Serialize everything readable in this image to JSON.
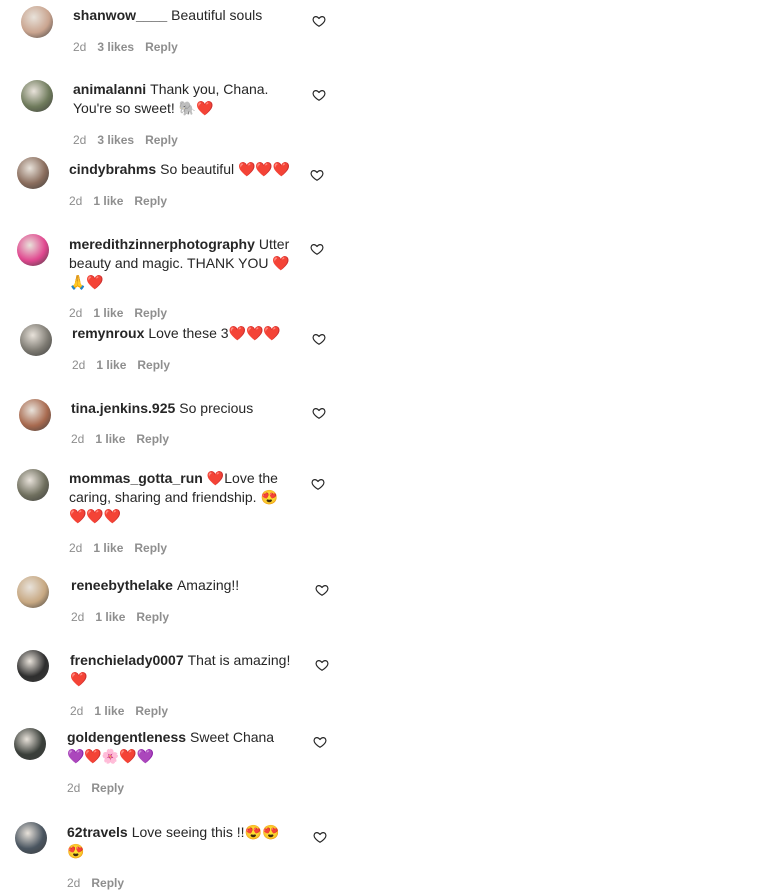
{
  "comments": [
    {
      "username": "shanwow____",
      "text": "Beautiful souls",
      "time": "2d",
      "likes": "3 likes",
      "reply": "Reply",
      "avatar_color": "#c9a48f"
    },
    {
      "username": "animalanni",
      "text": "Thank you, Chana. You're so sweet! 🐘❤️",
      "time": "2d",
      "likes": "3 likes",
      "reply": "Reply",
      "avatar_color": "#6f7b5c"
    },
    {
      "username": "cindybrahms",
      "text": "So beautiful ❤️❤️❤️",
      "time": "2d",
      "likes": "1 like",
      "reply": "Reply",
      "avatar_color": "#8a6d5d"
    },
    {
      "username": "meredithzinnerphotography",
      "text": "Utter beauty and magic. THANK YOU ❤️🙏❤️",
      "time": "2d",
      "likes": "1 like",
      "reply": "Reply",
      "avatar_color": "#e0478f"
    },
    {
      "username": "remynroux",
      "text": "Love these 3❤️❤️❤️",
      "time": "2d",
      "likes": "1 like",
      "reply": "Reply",
      "avatar_color": "#7d7a72"
    },
    {
      "username": "tina.jenkins.925",
      "text": "So precious",
      "time": "2d",
      "likes": "1 like",
      "reply": "Reply",
      "avatar_color": "#a86a4f"
    },
    {
      "username": "mommas_gotta_run",
      "text": "❤️Love the caring, sharing and friendship. 😍 ❤️❤️❤️",
      "time": "2d",
      "likes": "1 like",
      "reply": "Reply",
      "avatar_color": "#6f6f5e"
    },
    {
      "username": "reneebythelake",
      "text": "Amazing!!",
      "time": "2d",
      "likes": "1 like",
      "reply": "Reply",
      "avatar_color": "#c7a882"
    },
    {
      "username": "frenchielady0007",
      "text": "That is amazing!❤️",
      "time": "2d",
      "likes": "1 like",
      "reply": "Reply",
      "avatar_color": "#2e2e2e"
    },
    {
      "username": "goldengentleness",
      "text": "Sweet Chana 💜❤️🌸❤️💜",
      "time": "2d",
      "likes": "",
      "reply": "Reply",
      "avatar_color": "#3a3f3a"
    },
    {
      "username": "62travels",
      "text": "Love seeing this !!😍😍 😍",
      "time": "2d",
      "likes": "",
      "reply": "Reply",
      "avatar_color": "#4a5560"
    }
  ],
  "icons": {
    "like": "heart-outline-icon"
  },
  "colors": {
    "meta": "#8e8e8e",
    "text": "#262626",
    "heart_stroke": "#262626"
  }
}
